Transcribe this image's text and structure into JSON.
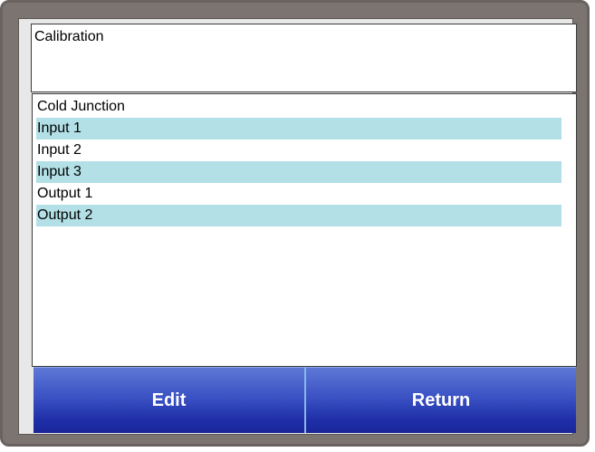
{
  "screen": {
    "title": "Calibration"
  },
  "calibration_list": {
    "items": [
      {
        "label": "Cold Junction",
        "highlighted": false
      },
      {
        "label": "Input 1",
        "highlighted": true
      },
      {
        "label": "Input 2",
        "highlighted": false
      },
      {
        "label": "Input 3",
        "highlighted": true
      },
      {
        "label": "Output 1",
        "highlighted": false
      },
      {
        "label": "Output 2",
        "highlighted": true
      }
    ]
  },
  "buttons": {
    "edit_label": "Edit",
    "return_label": "Return"
  },
  "colors": {
    "bezel": "#7b7470",
    "row_highlight": "#b2e0e6",
    "button_top": "#5e78d6",
    "button_bottom": "#1a2599",
    "button_text": "#ffffff"
  }
}
